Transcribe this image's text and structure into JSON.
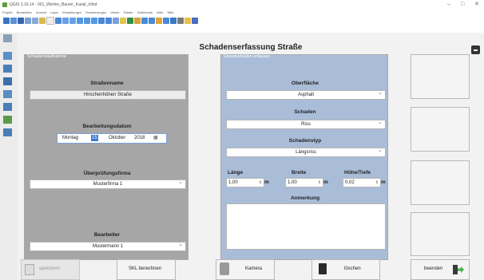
{
  "window": {
    "title": "QGIS 3.16.14 - 001_Werfen_Baurer_Kanal_Infod",
    "controls": {
      "minimize": "–",
      "maximize": "□",
      "close": "✕"
    }
  },
  "menubar": [
    "Projekt",
    "Bearbeiten",
    "Ansicht",
    "Layer",
    "Einstellungen",
    "Erweiterungen",
    "Vektor",
    "Raster",
    "Datenbank",
    "Web",
    "Hilfe"
  ],
  "dialog": {
    "title": "Schadenserfassung Straße",
    "left_panel": {
      "legend": "Schadensaufnahme",
      "street_label": "Straßenname",
      "street_value": "Hirschenhöhen Straße",
      "date_label": "Bearbeitungsdatum",
      "date": {
        "weekday": "Montag",
        "day": "15",
        "month": "Oktober",
        "year": "2018"
      },
      "company_label": "Überprüfungsfirma",
      "company_value": "Musterfirma 1",
      "editor_label": "Bearbeiter",
      "editor_value": "Mustermann 1"
    },
    "right_panel": {
      "legend": "Einzelschäden erfassen",
      "surface_label": "Oberfläche",
      "surface_value": "Asphalt",
      "damage_label": "Schaden",
      "damage_value": "Riss",
      "damagetype_label": "Schadenstyp",
      "damagetype_value": "Längsriss",
      "length_label": "Länge",
      "length_value": "1,00",
      "width_label": "Breite",
      "width_value": "1,00",
      "height_label": "Höhe/Tiefe",
      "height_value": "0,02",
      "unit": "m",
      "note_label": "Anmerkung",
      "note_value": ""
    },
    "buttons": {
      "save": "speichern",
      "skl": "SKL berechnen",
      "camera": "Kamera",
      "delete": "löschen",
      "quit": "beenden"
    }
  }
}
